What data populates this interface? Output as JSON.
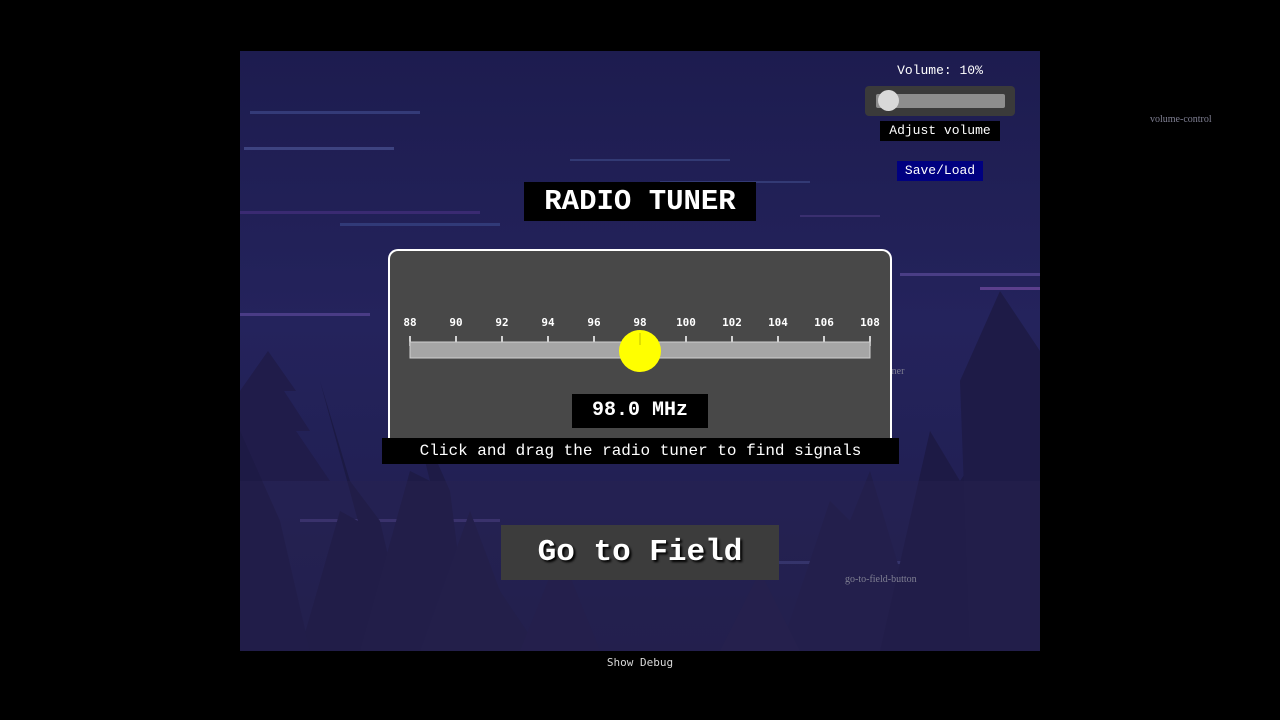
{
  "game": {
    "title": "RADIO TUNER"
  },
  "volume": {
    "label": "Volume: 10%",
    "level": 0.1,
    "caption": "Adjust volume"
  },
  "menu": {
    "save_load_label": "Save/Load"
  },
  "tuner": {
    "scale_labels": [
      "88",
      "90",
      "92",
      "94",
      "96",
      "98",
      "100",
      "102",
      "104",
      "106",
      "108"
    ],
    "frequency_mhz": 98.0,
    "frequency_display": "98.0 MHz",
    "range_mhz": [
      88,
      108
    ],
    "hint": "Click and drag the radio tuner to find signals",
    "knob_color": "#ffff00"
  },
  "actions": {
    "go_to_field_label": "Go to Field"
  },
  "debug": {
    "toggle_label": "Show Debug",
    "labels": {
      "volume_control": "volume-control",
      "radio_tuner": "radio-tuner",
      "go_to_field_button": "go-to-field-button"
    }
  },
  "colors": {
    "sky": "#211f52",
    "panel": "#484848",
    "save_button": "#000080"
  }
}
